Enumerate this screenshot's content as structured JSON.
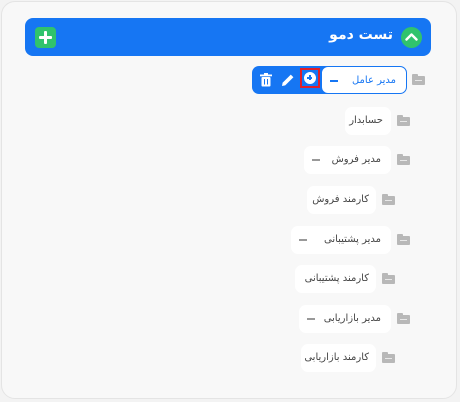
{
  "header": {
    "title": "تست دمو",
    "add_icon": "plus-square-icon",
    "collapse_icon": "chevron-up-icon"
  },
  "tree": {
    "selected": {
      "label": "مدیر عامل",
      "actions": [
        "add-child-icon",
        "edit-icon",
        "delete-icon"
      ]
    },
    "nodes": [
      {
        "label": "حسابدار"
      },
      {
        "label": "مدیر فروش"
      },
      {
        "label": "کارمند فروش"
      },
      {
        "label": "مدیر پشتیبانی"
      },
      {
        "label": "کارمند پشتیبانی"
      },
      {
        "label": "مدیر بازاریابی"
      },
      {
        "label": "کارمند بازاریابی"
      }
    ]
  },
  "colors": {
    "primary": "#1676f3",
    "accent_green": "#30c36d",
    "highlight_red": "#e0202a"
  }
}
